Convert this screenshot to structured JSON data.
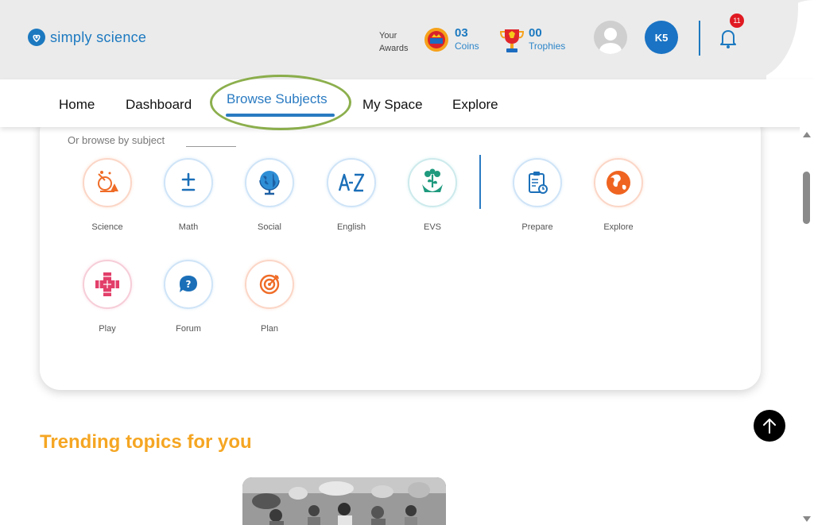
{
  "app": {
    "logo_text": "simply science",
    "brand_color": "#1c79c0"
  },
  "header": {
    "awards_line1": "Your",
    "awards_line2": "Awards",
    "coins": {
      "value": "03",
      "label": "Coins"
    },
    "trophies": {
      "value": "00",
      "label": "Trophies"
    },
    "user_initials": "K5",
    "notification_count": "11"
  },
  "nav": {
    "items": [
      {
        "label": "Home"
      },
      {
        "label": "Dashboard"
      },
      {
        "label": "Browse Subjects",
        "active": true
      },
      {
        "label": "My Space"
      },
      {
        "label": "Explore"
      }
    ]
  },
  "browse": {
    "label": "Or browse by subject",
    "subjects": [
      {
        "label": "Science",
        "icon": "science-icon"
      },
      {
        "label": "Math",
        "icon": "plus-minus-icon"
      },
      {
        "label": "Social",
        "icon": "globe-icon"
      },
      {
        "label": "English",
        "icon": "a-z-icon"
      },
      {
        "label": "EVS",
        "icon": "plant-hand-icon"
      },
      {
        "label": "Prepare",
        "icon": "clipboard-icon"
      },
      {
        "label": "Explore",
        "icon": "earth-icon"
      },
      {
        "label": "Play",
        "icon": "cross-puzzle-icon"
      },
      {
        "label": "Forum",
        "icon": "chat-question-icon"
      },
      {
        "label": "Plan",
        "icon": "target-icon"
      }
    ]
  },
  "trending": {
    "title": "Trending topics for you"
  },
  "colors": {
    "accent_orange": "#f5a623",
    "active_blue": "#2a7bc2",
    "badge_red": "#e01a22"
  }
}
